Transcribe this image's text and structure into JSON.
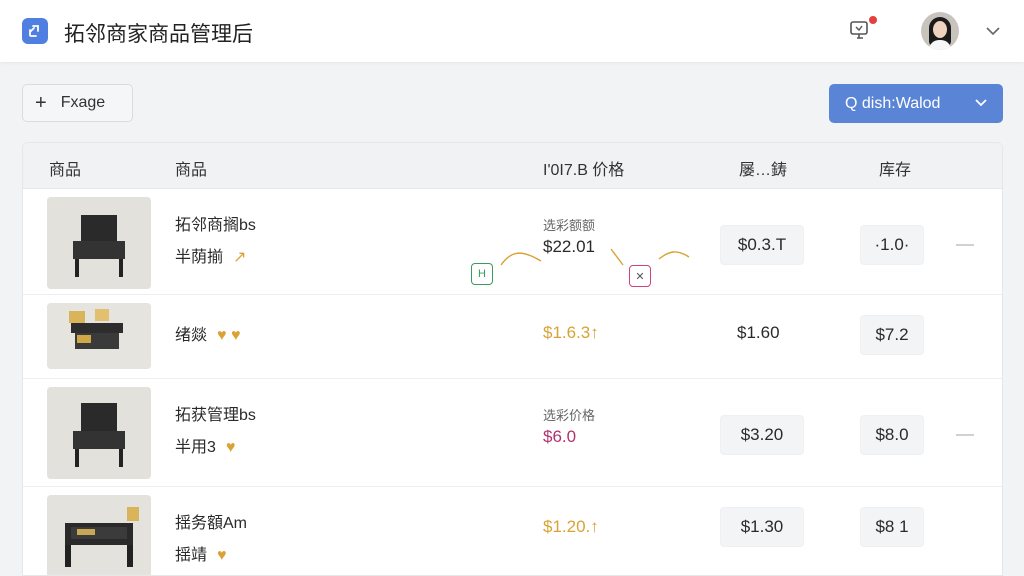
{
  "header": {
    "title": "拓邻商家商品管理后",
    "logo_icon": "link-icon",
    "notification_icon": "monitor-bell-icon",
    "avatar_icon": "user-avatar",
    "menu_icon": "chevron-down-icon"
  },
  "toolbar": {
    "add_label": "Fxage",
    "filter_label": "Q dish:Walod"
  },
  "table": {
    "columns": [
      "商品",
      "商品",
      "I'0I7.B 价格",
      "屡…鋳",
      "库存"
    ],
    "rows": [
      {
        "name": "拓邻商搁bs",
        "sub": "半荫揃",
        "tag": "↗",
        "price_label": "选彩额额",
        "price": "$22.01",
        "price_color": "#2a2a2a",
        "col4": "$0.3.T",
        "stock": "·1.0·"
      },
      {
        "name": "绪燚",
        "sub": "",
        "tag": "♥ ♥",
        "price_label": "",
        "price": "$1.6.3↑",
        "price_color": "#d9a235",
        "col4": "$1.60",
        "stock": "$7.2"
      },
      {
        "name": "拓获管理bs",
        "sub": "半用3",
        "tag": "♥",
        "price_label": "选彩价格",
        "price": "$6.0",
        "price_color": "#b0336f",
        "col4": "$3.20",
        "stock": "$8.0"
      },
      {
        "name": "揺务額Am",
        "sub": "揺靖",
        "tag": "♥",
        "price_label": "",
        "price": "$1.20.↑",
        "price_color": "#d9a235",
        "col4": "$1.30",
        "stock": "$8 1"
      }
    ]
  },
  "badges": {
    "green_icon": "h-icon",
    "pink_icon": "x-icon"
  },
  "colors": {
    "accent": "#5a84d6",
    "gold": "#d9a235",
    "magenta": "#b0336f",
    "badge_green": "#3a9d5d",
    "badge_pink": "#d0437a"
  }
}
